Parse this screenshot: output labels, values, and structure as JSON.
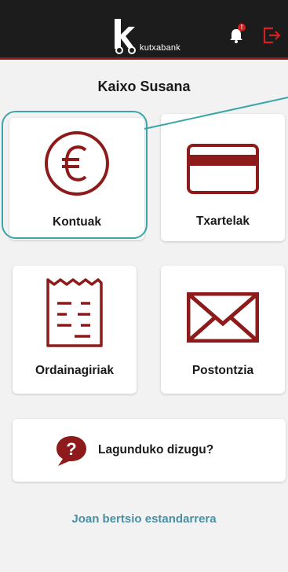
{
  "header": {
    "brand": "kutxabank",
    "notification_badge": "!"
  },
  "greeting": "Kaixo Susana",
  "tiles": [
    {
      "label": "Kontuak",
      "icon": "euro-icon"
    },
    {
      "label": "Txartelak",
      "icon": "credit-card-icon"
    },
    {
      "label": "Ordainagiriak",
      "icon": "receipt-icon"
    },
    {
      "label": "Postontzia",
      "icon": "envelope-icon"
    }
  ],
  "help": {
    "label": "Lagunduko dizugu?",
    "icon": "question-bubble-icon"
  },
  "std_link": "Joan bertsio estandarrera",
  "colors": {
    "brand_red": "#8e1b1b",
    "highlight_teal": "#3aa6a6",
    "link_blue": "#4a90a4",
    "header_bg": "#1c1c1c"
  }
}
